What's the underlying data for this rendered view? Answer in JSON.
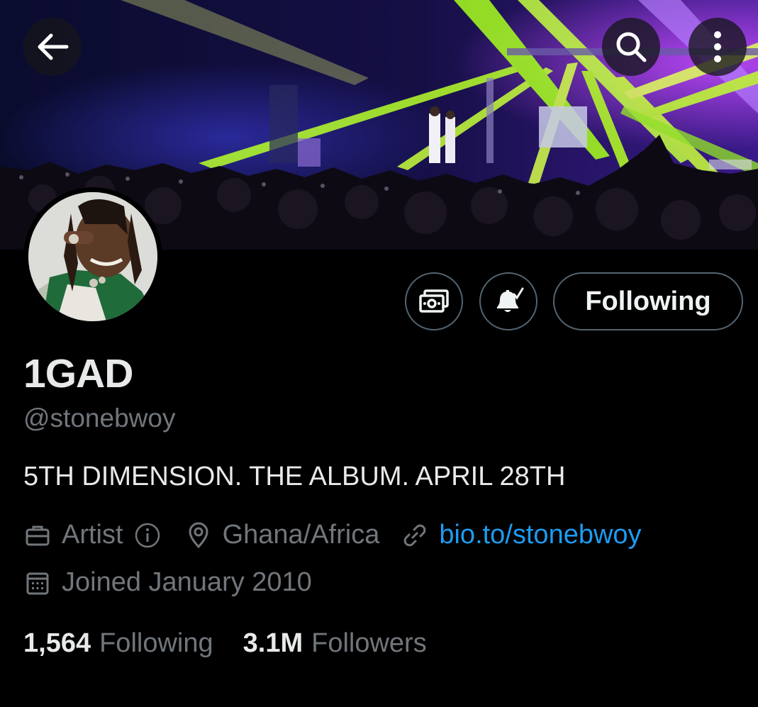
{
  "header": {
    "back_icon": "arrow-left-icon",
    "search_icon": "search-icon",
    "more_icon": "more-vertical-icon"
  },
  "profile": {
    "display_name": "1GAD",
    "handle": "@stonebwoy",
    "bio": "5TH DIMENSION. THE ALBUM. APRIL 28TH",
    "category": "Artist",
    "location": "Ghana/Africa",
    "website": "bio.to/stonebwoy",
    "joined": "Joined January 2010"
  },
  "actions": {
    "tip_icon": "money-icon",
    "notify_icon": "bell-check-icon",
    "follow_label": "Following"
  },
  "stats": {
    "following_count": "1,564",
    "following_label": "Following",
    "followers_count": "3.1M",
    "followers_label": "Followers"
  },
  "colors": {
    "background": "#000000",
    "text_primary": "#e7e9ea",
    "text_secondary": "#71767b",
    "link": "#1d9bf0",
    "border": "#536471"
  }
}
